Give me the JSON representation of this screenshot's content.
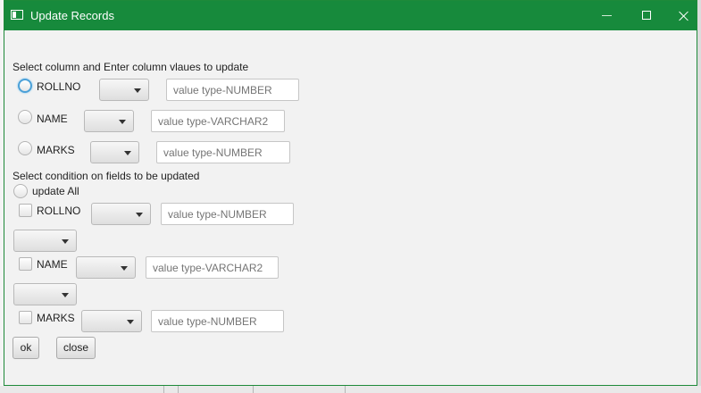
{
  "window": {
    "title": "Update Records"
  },
  "update_section": {
    "heading": "Select column and Enter column vlaues to update",
    "rows": [
      {
        "label": "ROLLNO",
        "placeholder": "value type-NUMBER"
      },
      {
        "label": "NAME",
        "placeholder": "value type-VARCHAR2"
      },
      {
        "label": "MARKS",
        "placeholder": "value type-NUMBER"
      }
    ]
  },
  "condition_section": {
    "heading": "Select condition on fields to be updated",
    "update_all_label": "update All",
    "rows": [
      {
        "label": "ROLLNO",
        "placeholder": "value type-NUMBER"
      },
      {
        "label": "NAME",
        "placeholder": "value type-VARCHAR2"
      },
      {
        "label": "MARKS",
        "placeholder": "value type-NUMBER"
      }
    ]
  },
  "buttons": {
    "ok": "ok",
    "close": "close"
  },
  "icons": {
    "minimize": "minimize-icon",
    "maximize": "maximize-icon",
    "close": "close-icon",
    "app": "app-window-icon"
  },
  "colors": {
    "titlebar": "#178a3c",
    "focus": "#4aa0d8"
  }
}
